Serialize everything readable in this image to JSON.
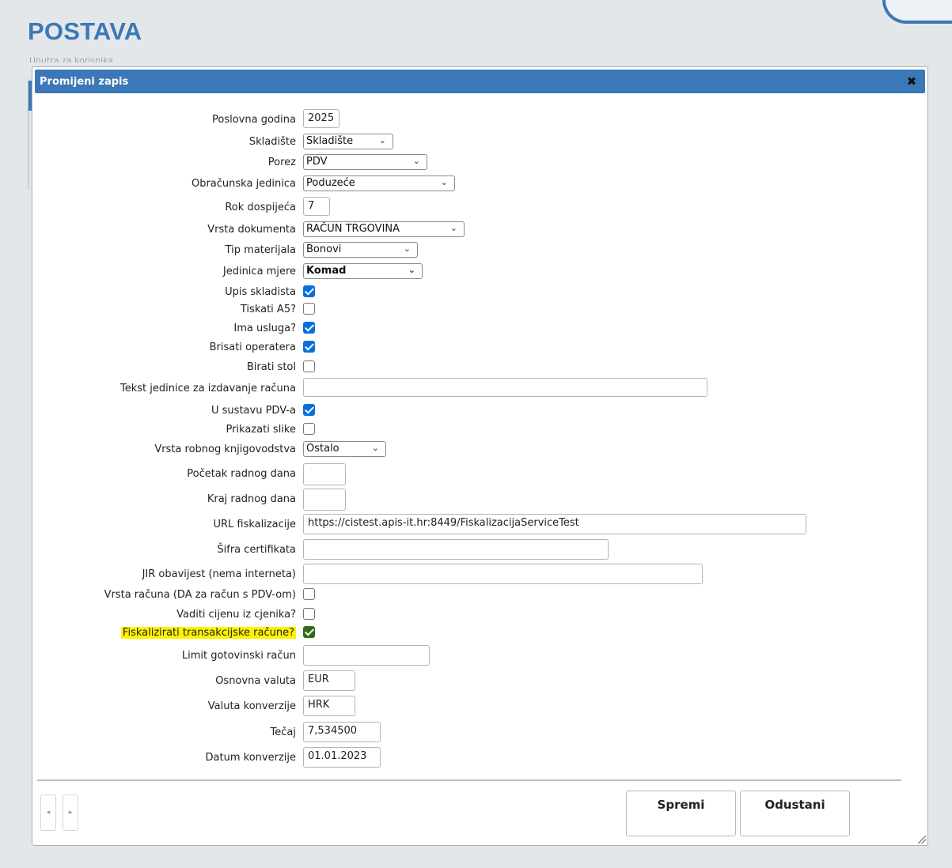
{
  "page": {
    "title": "POSTAVA",
    "subtitle": "Unutra za korisnika"
  },
  "dialog": {
    "title": "Promijeni zapis",
    "close_label": "✖"
  },
  "fields": {
    "poslovna_godina": {
      "label": "Poslovna godina",
      "value": "2025"
    },
    "skladiste": {
      "label": "Skladište",
      "value": "Skladište"
    },
    "porez": {
      "label": "Porez",
      "value": "PDV"
    },
    "obracunska_jedinica": {
      "label": "Obračunska jedinica",
      "value": "Poduzeće"
    },
    "rok_dospijeca": {
      "label": "Rok dospijeća",
      "value": "7"
    },
    "vrsta_dokumenta": {
      "label": "Vrsta dokumenta",
      "value": "RAČUN TRGOVINA"
    },
    "tip_materijala": {
      "label": "Tip materijala",
      "value": "Bonovi"
    },
    "jedinica_mjere": {
      "label": "Jedinica mjere",
      "value": "Komad"
    },
    "upis_skladista": {
      "label": "Upis skladista",
      "checked": true
    },
    "tiskati_a5": {
      "label": "Tiskati A5?",
      "checked": false
    },
    "ima_usluga": {
      "label": "Ima usluga?",
      "checked": true
    },
    "brisati_operatera": {
      "label": "Brisati operatera",
      "checked": true
    },
    "birati_stol": {
      "label": "Birati stol",
      "checked": false
    },
    "tekst_jedinice": {
      "label": "Tekst jedinice za izdavanje računa",
      "value": ""
    },
    "u_sustavu_pdv": {
      "label": "U sustavu PDV-a",
      "checked": true
    },
    "prikazati_slike": {
      "label": "Prikazati slike",
      "checked": false
    },
    "vrsta_robnog": {
      "label": "Vrsta robnog knjigovodstva",
      "value": "Ostalo"
    },
    "pocetak_radnog_dana": {
      "label": "Početak radnog dana",
      "value": ""
    },
    "kraj_radnog_dana": {
      "label": "Kraj radnog dana",
      "value": ""
    },
    "url_fiskalizacije": {
      "label": "URL fiskalizacije",
      "value": "https://cistest.apis-it.hr:8449/FiskalizacijaServiceTest"
    },
    "sifra_certifikata": {
      "label": "Šifra certifikata",
      "value": ""
    },
    "jir_obavijest": {
      "label": "JIR obavijest (nema interneta)",
      "value": ""
    },
    "vrsta_racuna": {
      "label": "Vrsta računa (DA za račun s PDV-om)",
      "checked": false
    },
    "vaditi_cijenu": {
      "label": "Vaditi cijenu iz cjenika?",
      "checked": false
    },
    "fiskalizirati": {
      "label": "Fiskalizirati transakcijske račune?",
      "checked": true,
      "highlight_color": "#fff200"
    },
    "limit_gotovinski": {
      "label": "Limit gotovinski račun",
      "value": ""
    },
    "osnovna_valuta": {
      "label": "Osnovna valuta",
      "value": "EUR"
    },
    "valuta_konverzije": {
      "label": "Valuta konverzije",
      "value": "HRK"
    },
    "tecaj": {
      "label": "Tečaj",
      "value": "7,534500"
    },
    "datum_konverzije": {
      "label": "Datum konverzije",
      "value": "01.01.2023"
    }
  },
  "footer": {
    "prev_label": "◂",
    "next_label": "▸",
    "save_label": "Spremi",
    "cancel_label": "Odustani"
  },
  "colors": {
    "accent": "#3b78b7",
    "checkbox_checked": "#0a6fde",
    "highlight": "#fff200"
  },
  "icons": {
    "close": "close-icon",
    "chevron": "chevron-down-icon",
    "check": "checkmark-icon"
  }
}
